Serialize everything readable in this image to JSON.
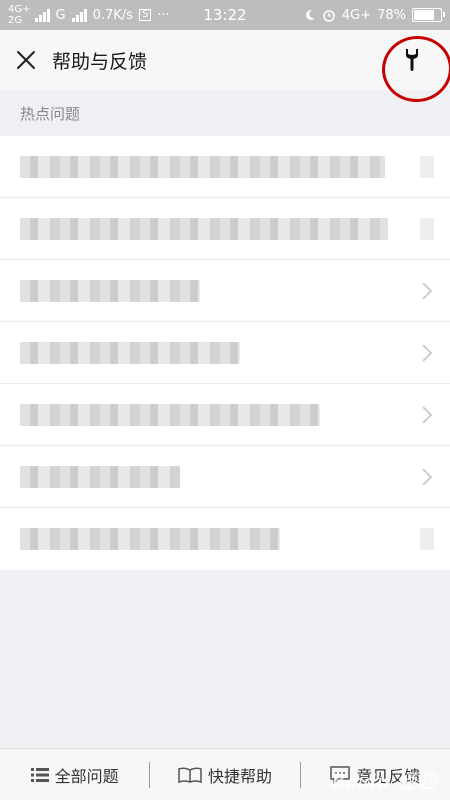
{
  "status_bar": {
    "network_top": "4G+",
    "network_bottom": "2G",
    "carrier_g": "G",
    "speed": "0.7K/s",
    "sim_icon_letter": "S",
    "more": "···",
    "time": "13:22",
    "network_right": "4G+",
    "battery": "78%",
    "battery_level": 0.78
  },
  "header": {
    "title": "帮助与反馈"
  },
  "section": {
    "label": "热点问题"
  },
  "list": {
    "item_count": 7
  },
  "bottom_bar": {
    "tabs": [
      {
        "label": "全部问题"
      },
      {
        "label": "快捷帮助"
      },
      {
        "label": "意见反馈"
      }
    ]
  },
  "watermark": "Baidu 经验",
  "colors": {
    "annotation_circle": "#c40000",
    "background": "#efeff4",
    "header_bg": "#f7f7f7"
  }
}
